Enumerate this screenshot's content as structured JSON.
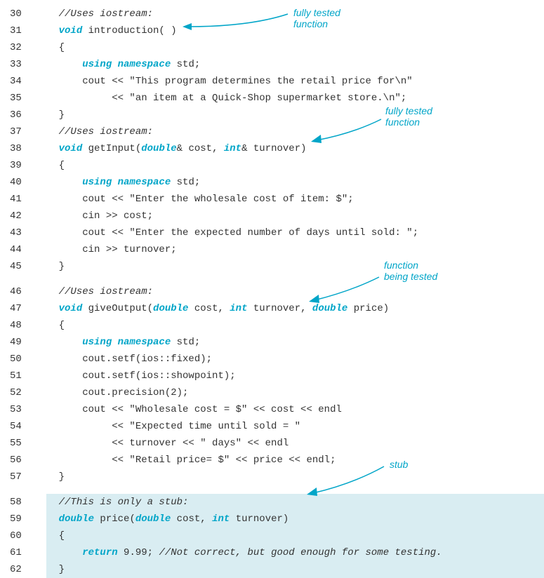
{
  "annotations": {
    "tested1": "fully tested\nfunction",
    "tested2": "fully tested\nfunction",
    "beingtested": "function\nbeing tested",
    "stub": "stub"
  },
  "lines": [
    {
      "n": "30",
      "parts": [
        {
          "t": "    "
        },
        {
          "t": "//Uses iostream:",
          "c": "com"
        }
      ]
    },
    {
      "n": "31",
      "parts": [
        {
          "t": "    "
        },
        {
          "t": "void",
          "c": "kw"
        },
        {
          "t": " introduction( )"
        }
      ]
    },
    {
      "n": "32",
      "parts": [
        {
          "t": "    {"
        }
      ]
    },
    {
      "n": "33",
      "parts": [
        {
          "t": "        "
        },
        {
          "t": "using namespace",
          "c": "kw"
        },
        {
          "t": " std;"
        }
      ]
    },
    {
      "n": "34",
      "parts": [
        {
          "t": "        cout << \"This program determines the retail price for\\n\""
        }
      ]
    },
    {
      "n": "35",
      "parts": [
        {
          "t": "             << \"an item at a Quick-Shop supermarket store.\\n\";"
        }
      ]
    },
    {
      "n": "36",
      "parts": [
        {
          "t": "    }"
        }
      ]
    },
    {
      "n": "37",
      "parts": [
        {
          "t": "    "
        },
        {
          "t": "//Uses iostream:",
          "c": "com"
        }
      ]
    },
    {
      "n": "38",
      "parts": [
        {
          "t": "    "
        },
        {
          "t": "void",
          "c": "kw"
        },
        {
          "t": " getInput("
        },
        {
          "t": "double",
          "c": "kw"
        },
        {
          "t": "& cost, "
        },
        {
          "t": "int",
          "c": "kw"
        },
        {
          "t": "& turnover)"
        }
      ]
    },
    {
      "n": "39",
      "parts": [
        {
          "t": "    {"
        }
      ]
    },
    {
      "n": "40",
      "parts": [
        {
          "t": "        "
        },
        {
          "t": "using namespace",
          "c": "kw"
        },
        {
          "t": " std;"
        }
      ]
    },
    {
      "n": "41",
      "parts": [
        {
          "t": "        cout << \"Enter the wholesale cost of item: $\";"
        }
      ]
    },
    {
      "n": "42",
      "parts": [
        {
          "t": "        cin >> cost;"
        }
      ]
    },
    {
      "n": "43",
      "parts": [
        {
          "t": "        cout << \"Enter the expected number of days until sold: \";"
        }
      ]
    },
    {
      "n": "44",
      "parts": [
        {
          "t": "        cin >> turnover;"
        }
      ]
    },
    {
      "n": "45",
      "parts": [
        {
          "t": "    }"
        }
      ]
    },
    {
      "gap": true
    },
    {
      "n": "46",
      "parts": [
        {
          "t": "    "
        },
        {
          "t": "//Uses iostream:",
          "c": "com"
        }
      ]
    },
    {
      "n": "47",
      "parts": [
        {
          "t": "    "
        },
        {
          "t": "void",
          "c": "kw"
        },
        {
          "t": " giveOutput("
        },
        {
          "t": "double",
          "c": "kw"
        },
        {
          "t": " cost, "
        },
        {
          "t": "int",
          "c": "kw"
        },
        {
          "t": " turnover, "
        },
        {
          "t": "double",
          "c": "kw"
        },
        {
          "t": " price)"
        }
      ]
    },
    {
      "n": "48",
      "parts": [
        {
          "t": "    {"
        }
      ]
    },
    {
      "n": "49",
      "parts": [
        {
          "t": "        "
        },
        {
          "t": "using namespace",
          "c": "kw"
        },
        {
          "t": " std;"
        }
      ]
    },
    {
      "n": "50",
      "parts": [
        {
          "t": "        cout.setf(ios::fixed);"
        }
      ]
    },
    {
      "n": "51",
      "parts": [
        {
          "t": "        cout.setf(ios::showpoint);"
        }
      ]
    },
    {
      "n": "52",
      "parts": [
        {
          "t": "        cout.precision(2);"
        }
      ]
    },
    {
      "n": "53",
      "parts": [
        {
          "t": "        cout << \"Wholesale cost = $\" << cost << endl"
        }
      ]
    },
    {
      "n": "54",
      "parts": [
        {
          "t": "             << \"Expected time until sold = \""
        }
      ]
    },
    {
      "n": "55",
      "parts": [
        {
          "t": "             << turnover << \" days\" << endl"
        }
      ]
    },
    {
      "n": "56",
      "parts": [
        {
          "t": "             << \"Retail price= $\" << price << endl;"
        }
      ]
    },
    {
      "n": "57",
      "parts": [
        {
          "t": "    }"
        }
      ]
    },
    {
      "gap": true
    },
    {
      "n": "58",
      "parts": [
        {
          "t": "    "
        },
        {
          "t": "//This is only a stub:",
          "c": "com"
        }
      ],
      "hl": true
    },
    {
      "n": "59",
      "parts": [
        {
          "t": "    "
        },
        {
          "t": "double",
          "c": "kw"
        },
        {
          "t": " price("
        },
        {
          "t": "double",
          "c": "kw"
        },
        {
          "t": " cost, "
        },
        {
          "t": "int",
          "c": "kw"
        },
        {
          "t": " turnover)"
        }
      ],
      "hl": true
    },
    {
      "n": "60",
      "parts": [
        {
          "t": "    {"
        }
      ],
      "hl": true
    },
    {
      "n": "61",
      "parts": [
        {
          "t": "        "
        },
        {
          "t": "return",
          "c": "kw"
        },
        {
          "t": " 9.99; "
        },
        {
          "t": "//Not correct, but good enough for some testing.",
          "c": "com"
        }
      ],
      "hl": true
    },
    {
      "n": "62",
      "parts": [
        {
          "t": "    }"
        }
      ],
      "hl": true
    }
  ]
}
